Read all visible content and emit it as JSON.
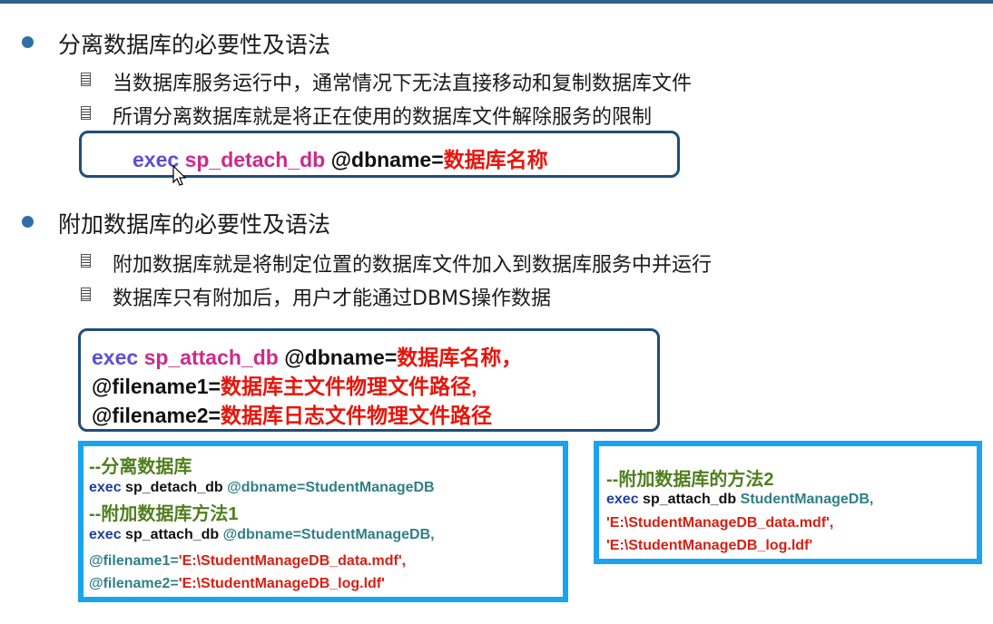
{
  "section1": {
    "heading": "分离数据库的必要性及语法",
    "points": [
      "当数据库服务运行中，通常情况下无法直接移动和复制数据库文件",
      "所谓分离数据库就是将正在使用的数据库文件解除服务的限制"
    ],
    "syntax": {
      "exec": "exec",
      "proc": "sp_detach_db",
      "param": "@dbname=",
      "value": "数据库名称"
    }
  },
  "section2": {
    "heading": "附加数据库的必要性及语法",
    "points": [
      "附加数据库就是将制定位置的数据库文件加入到数据库服务中并运行",
      "数据库只有附加后，用户才能通过DBMS操作数据"
    ],
    "syntax": {
      "exec": "exec",
      "proc": "sp_attach_db",
      "param1": "@dbname=",
      "value1": "数据库名称，",
      "param2": "@filename1=",
      "value2": "数据库主文件物理文件路径,",
      "param3": "@filename2=",
      "value3": "数据库日志文件物理文件路径"
    }
  },
  "example_left": {
    "comment1": "--分离数据库",
    "l1_exec": "exec",
    "l1_proc": "sp_detach_db",
    "l1_param": "@dbname=StudentManageDB",
    "comment2": "--附加数据库方法1",
    "l2_exec": "exec",
    "l2_proc": "sp_attach_db",
    "l2_param": "@dbname=StudentManageDB,",
    "l3_param": "@filename1=",
    "l3_str": "'E:\\StudentManageDB_data.mdf',",
    "l4_param": "@filename2=",
    "l4_str": "'E:\\StudentManageDB_log.ldf'"
  },
  "example_right": {
    "comment": "--附加数据库的方法2",
    "l1_exec": "exec",
    "l1_proc": "sp_attach_db",
    "l1_param": "StudentManageDB,",
    "l2_str": "'E:\\StudentManageDB_data.mdf',",
    "l3_str": "'E:\\StudentManageDB_log.ldf'"
  },
  "colors": {
    "accent": "#2e6fa8",
    "box_border": "#1f4e79",
    "code_border": "#1aa3ef",
    "red": "#e8140a"
  }
}
